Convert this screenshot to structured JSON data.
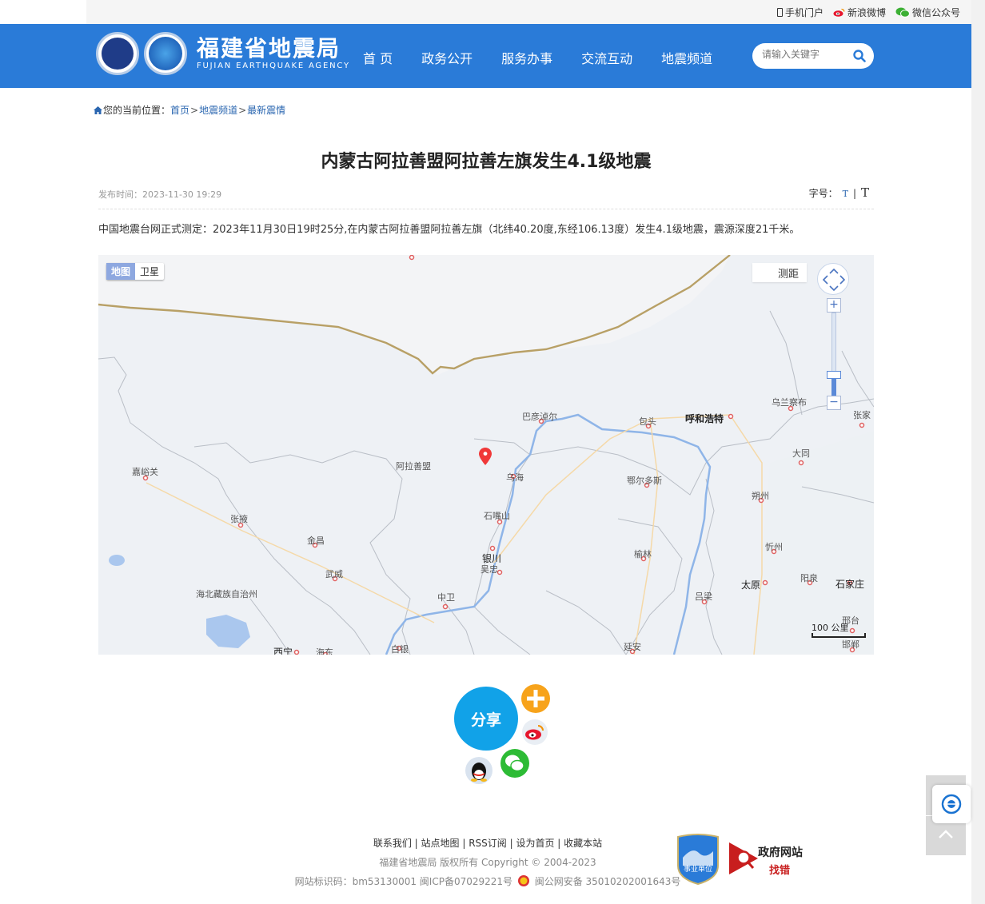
{
  "topbar": {
    "mobile": "手机门户",
    "weibo": "新浪微博",
    "wechat": "微信公众号"
  },
  "header": {
    "logo_cn": "福建省地震局",
    "logo_en": "FUJIAN EARTHQUAKE AGENCY",
    "nav": [
      "首 页",
      "政务公开",
      "服务办事",
      "交流互动",
      "地震频道"
    ],
    "search_placeholder": "请输入关键字",
    "brand_color": "#2a7bd8"
  },
  "breadcrumb": {
    "prefix": "您的当前位置：",
    "items": [
      "首页",
      "地震频道",
      "最新震情"
    ],
    "sep": ">"
  },
  "article": {
    "title": "内蒙古阿拉善盟阿拉善左旗发生4.1级地震",
    "date": "发布时间：2023-11-30 19:29",
    "font_label": "字号：",
    "font_small": "T",
    "font_sep": "|",
    "font_big": "T",
    "body": "中国地震台网正式测定：2023年11月30日19时25分,在内蒙古阿拉善盟阿拉善左旗（北纬40.20度,东经106.13度）发生4.1级地震，震源深度21千米。"
  },
  "map": {
    "type_map": "地图",
    "type_satellite": "卫星",
    "measure": "测距",
    "zoom_in": "+",
    "zoom_out": "−",
    "zoom_mid": "−",
    "scale": "100 公里",
    "labels": {
      "bayannur": "巴彦淖尔",
      "baotou": "包头",
      "hohhot": "呼和浩特",
      "ulanqab": "乌兰察布",
      "zhangjiakou": "张家",
      "datong": "大同",
      "alxa": "阿拉善盟",
      "wuhai": "乌海",
      "ordos": "鄂尔多斯",
      "shuozhou": "朔州",
      "jiayuguan": "嘉峪关",
      "shizuishan": "石嘴山",
      "zhangye": "张掖",
      "jinchang": "金昌",
      "yinchuan": "银川",
      "wuzhong": "吴忠",
      "yulin": "榆林",
      "xinzhou": "忻州",
      "wuwei": "武威",
      "haibei": "海北藏族自治州",
      "zhongwei": "中卫",
      "taiyuan": "太原",
      "yangquan": "阳泉",
      "shijiazhuang": "石家庄",
      "lvliang": "吕梁",
      "xingtai": "邢台",
      "handan": "邯郸",
      "xining": "西宁",
      "haidong": "海东",
      "baiyin": "白银",
      "yanan": "延安"
    }
  },
  "share": {
    "label": "分享"
  },
  "footer": {
    "links": "联系我们 | 站点地图 | RSS订阅 | 设为首页 | 收藏本站",
    "copyright": "福建省地震局   版权所有    Copyright © 2004-2023",
    "ids": "网站标识码：bm53130001   闽ICP备07029221号",
    "police": "闽公网安备 35010202001643号",
    "gov_badge_1": "政府网站",
    "gov_badge_2": "找错",
    "unit_badge": "事业单位"
  }
}
